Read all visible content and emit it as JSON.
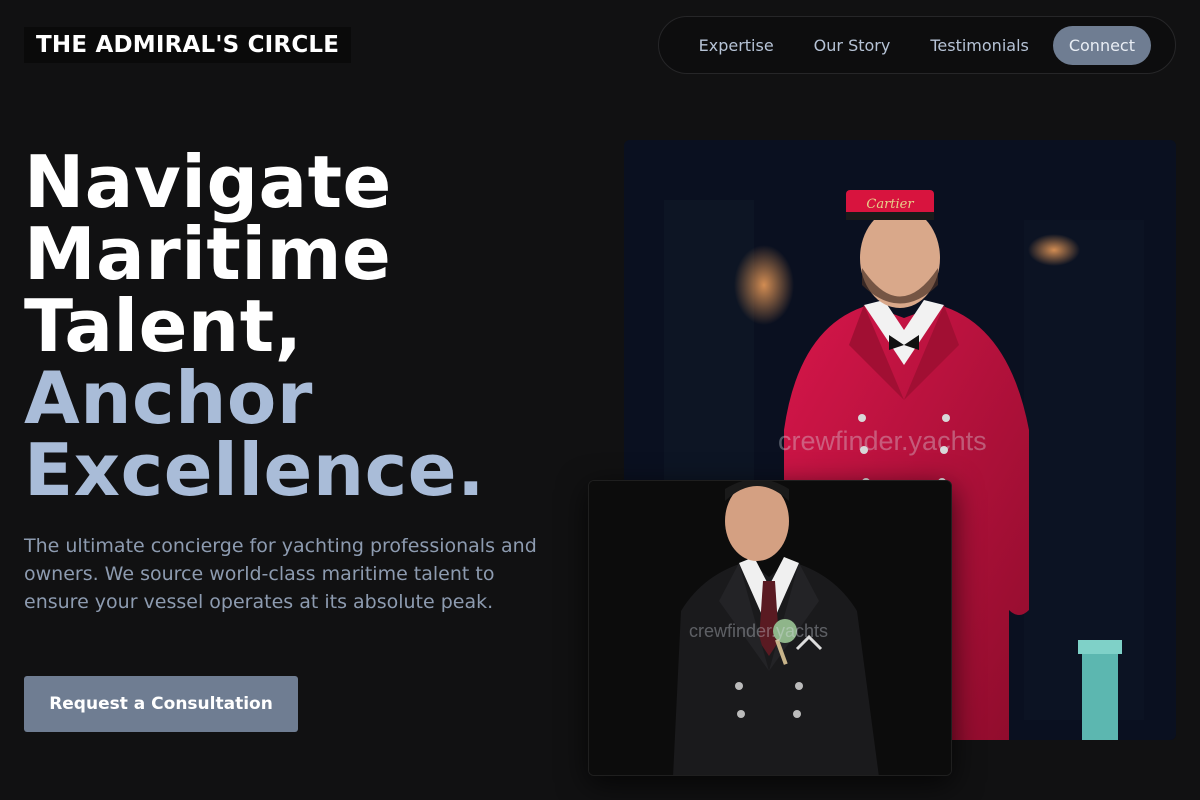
{
  "brand": {
    "name": "THE ADMIRAL'S CIRCLE"
  },
  "nav": {
    "items": [
      {
        "label": "Expertise"
      },
      {
        "label": "Our Story"
      },
      {
        "label": "Testimonials"
      }
    ],
    "cta": "Connect"
  },
  "hero": {
    "title_lines": [
      "Navigate",
      "Maritime",
      "Talent,"
    ],
    "accent_lines": [
      "Anchor",
      "Excellence."
    ],
    "subtitle": "The ultimate concierge for yachting professionals and owners. We source world-class maritime talent to ensure your vessel operates at its absolute peak.",
    "button": "Request a Consultation"
  },
  "images": {
    "main": {
      "watermark": "crewfinder.yachts",
      "cap_text": "Cartier"
    },
    "inset": {
      "watermark": "crewfinder.yachts"
    }
  },
  "colors": {
    "background": "#111112",
    "accent": "#a9bcd8",
    "button": "#6f7d92",
    "jacket": "#c1123c"
  }
}
